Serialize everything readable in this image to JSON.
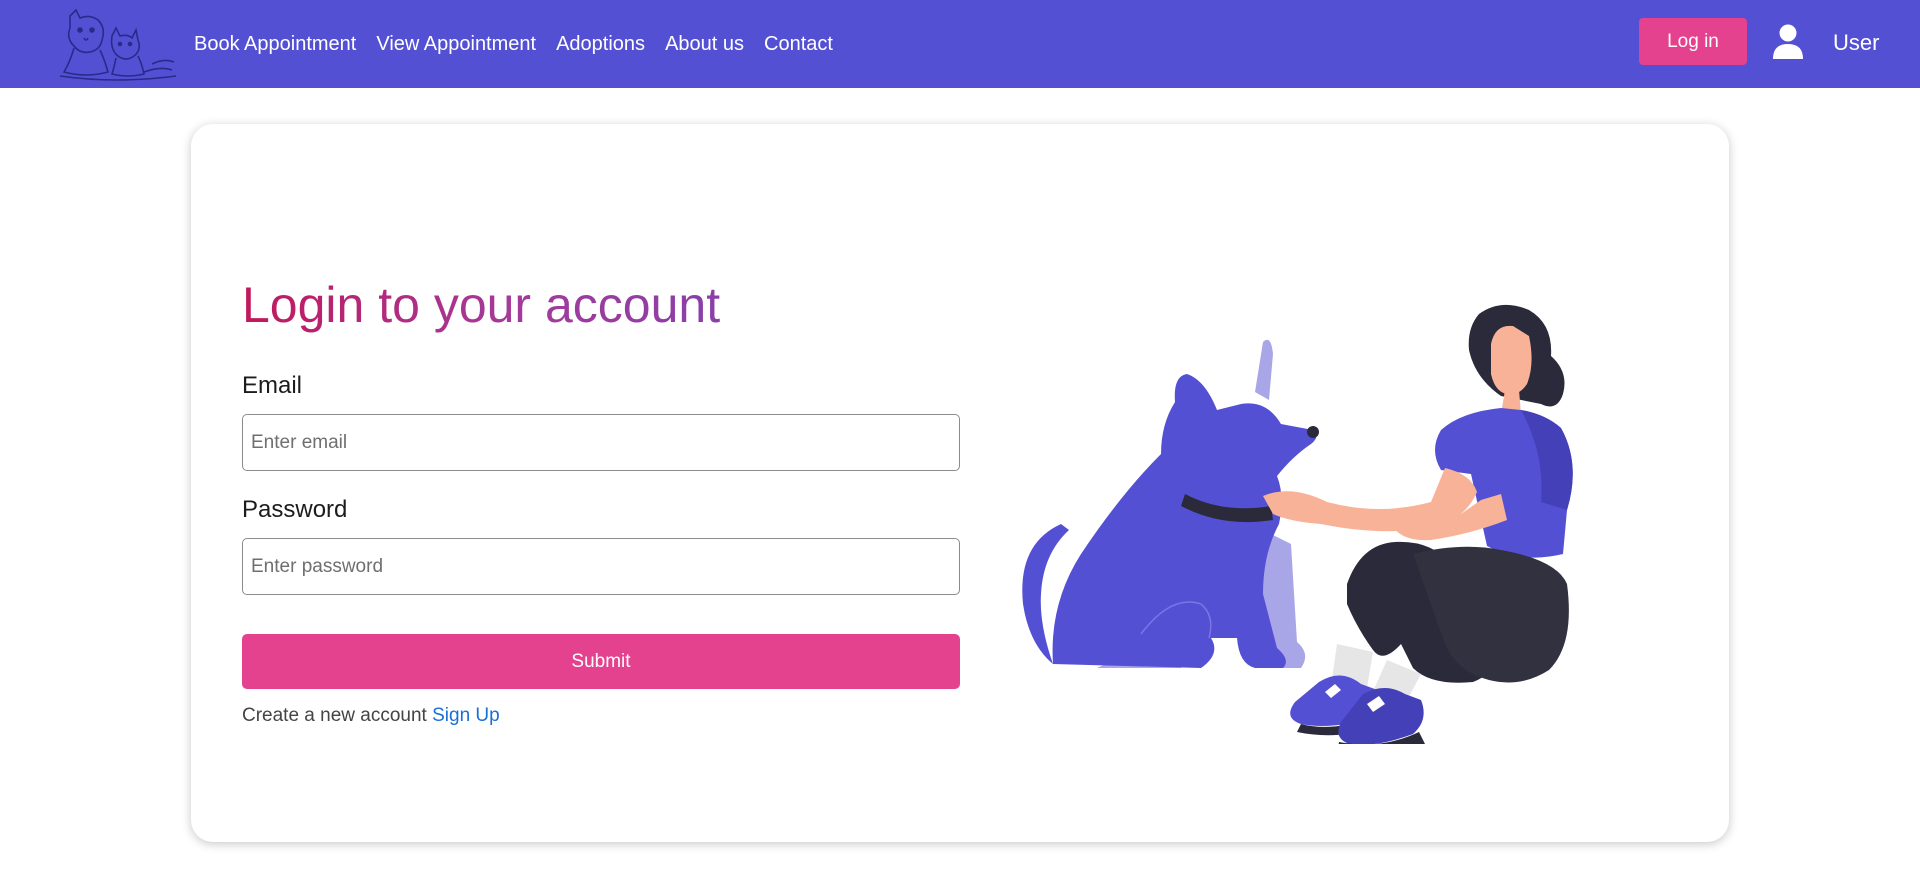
{
  "navbar": {
    "logo_icon": "dog-and-cat-logo-icon",
    "links": [
      "Book Appointment",
      "View Appointment",
      "Adoptions",
      "About us",
      "Contact"
    ],
    "login_label": "Log in",
    "user_icon": "user-icon",
    "user_label": "User"
  },
  "login_form": {
    "title": "Login to your account",
    "email_label": "Email",
    "email_placeholder": "Enter email",
    "email_value": "",
    "password_label": "Password",
    "password_placeholder": "Enter password",
    "password_value": "",
    "submit_label": "Submit",
    "signup_prompt": "Create a new account",
    "signup_link": "Sign Up"
  },
  "illustration": {
    "icon": "woman-petting-dog-illustration"
  },
  "colors": {
    "navbar_bg": "#5450d4",
    "accent_pink": "#e4418e",
    "link_blue": "#1a6fd6",
    "title_gradient_start": "#c2185b",
    "title_gradient_end": "#8a3fa8"
  }
}
